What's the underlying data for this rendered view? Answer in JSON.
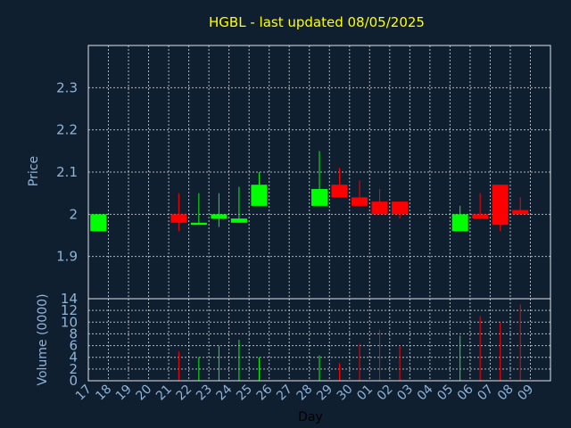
{
  "chart_data": [
    {
      "type": "candlestick",
      "title": "HGBL - last updated 08/05/2025",
      "ylabel": "Price",
      "ylim": [
        1.8,
        2.4
      ],
      "yticks": [
        "1.9",
        "2",
        "2.1",
        "2.2",
        "2.3"
      ],
      "grid": true,
      "up_color": "#00ff00",
      "down_color": "#ff0000",
      "x": [
        "17",
        "18",
        "19",
        "20",
        "21",
        "22",
        "23",
        "24",
        "25",
        "26",
        "27",
        "28",
        "29",
        "30",
        "01",
        "02",
        "03",
        "04",
        "05",
        "06",
        "07",
        "08",
        "09"
      ],
      "candles": [
        {
          "x": "17",
          "open": 1.96,
          "close": 2.0,
          "high": 2.0,
          "low": 1.96
        },
        {
          "x": "21",
          "open": 2.0,
          "close": 1.98,
          "high": 2.05,
          "low": 1.96
        },
        {
          "x": "22",
          "open": 1.975,
          "close": 1.98,
          "high": 2.05,
          "low": 1.975
        },
        {
          "x": "23",
          "open": 1.99,
          "close": 2.0,
          "high": 2.05,
          "low": 1.97
        },
        {
          "x": "24",
          "open": 1.98,
          "close": 1.99,
          "high": 2.065,
          "low": 1.98
        },
        {
          "x": "25",
          "open": 2.02,
          "close": 2.07,
          "high": 2.1,
          "low": 2.02
        },
        {
          "x": "28",
          "open": 2.02,
          "close": 2.06,
          "high": 2.15,
          "low": 2.02
        },
        {
          "x": "29",
          "open": 2.07,
          "close": 2.04,
          "high": 2.11,
          "low": 2.04
        },
        {
          "x": "30",
          "open": 2.04,
          "close": 2.02,
          "high": 2.08,
          "low": 2.02
        },
        {
          "x": "01",
          "open": 2.03,
          "close": 2.0,
          "high": 2.06,
          "low": 2.0
        },
        {
          "x": "02",
          "open": 2.03,
          "close": 2.0,
          "high": 2.03,
          "low": 1.99
        },
        {
          "x": "05",
          "open": 1.96,
          "close": 2.0,
          "high": 2.02,
          "low": 1.96
        },
        {
          "x": "06",
          "open": 2.0,
          "close": 1.99,
          "high": 2.05,
          "low": 1.99
        },
        {
          "x": "07",
          "open": 2.07,
          "close": 1.975,
          "high": 2.07,
          "low": 1.96
        },
        {
          "x": "08",
          "open": 2.01,
          "close": 2.0,
          "high": 2.04,
          "low": 2.0
        }
      ]
    },
    {
      "type": "bar",
      "ylabel": "Volume (0000)",
      "xlabel": "Day",
      "ylim": [
        0,
        14
      ],
      "yticks": [
        "0",
        "2",
        "4",
        "6",
        "8",
        "10",
        "12",
        "14"
      ],
      "grid": true,
      "bars": [
        {
          "x": "21",
          "value": 5.0,
          "dir": "down"
        },
        {
          "x": "22",
          "value": 4.0,
          "dir": "up"
        },
        {
          "x": "23",
          "value": 6.0,
          "dir": "up"
        },
        {
          "x": "24",
          "value": 7.0,
          "dir": "up"
        },
        {
          "x": "25",
          "value": 4.0,
          "dir": "up"
        },
        {
          "x": "28",
          "value": 4.3,
          "dir": "up"
        },
        {
          "x": "29",
          "value": 3.0,
          "dir": "down"
        },
        {
          "x": "30",
          "value": 6.3,
          "dir": "down"
        },
        {
          "x": "01",
          "value": 8.7,
          "dir": "down"
        },
        {
          "x": "02",
          "value": 6.0,
          "dir": "down"
        },
        {
          "x": "05",
          "value": 7.7,
          "dir": "up"
        },
        {
          "x": "06",
          "value": 11.0,
          "dir": "down"
        },
        {
          "x": "07",
          "value": 10.0,
          "dir": "down"
        },
        {
          "x": "08",
          "value": 13.0,
          "dir": "down"
        }
      ]
    }
  ]
}
